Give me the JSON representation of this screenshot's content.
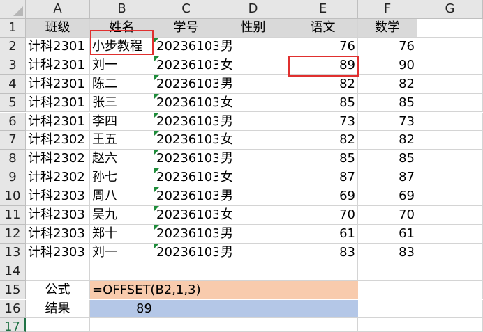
{
  "columns": [
    "A",
    "B",
    "C",
    "D",
    "E",
    "F",
    "G"
  ],
  "rows": [
    "1",
    "2",
    "3",
    "4",
    "5",
    "6",
    "7",
    "8",
    "9",
    "10",
    "11",
    "12",
    "13",
    "14",
    "15",
    "16",
    "17"
  ],
  "headers": [
    "班级",
    "姓名",
    "学号",
    "性别",
    "语文",
    "数学"
  ],
  "records": [
    [
      "计科2301",
      "小步教程",
      "20236103",
      "男",
      "76",
      "76"
    ],
    [
      "计科2301",
      "刘一",
      "20236103",
      "女",
      "89",
      "90"
    ],
    [
      "计科2301",
      "陈二",
      "20236103",
      "男",
      "82",
      "82"
    ],
    [
      "计科2301",
      "张三",
      "20236103",
      "女",
      "85",
      "85"
    ],
    [
      "计科2301",
      "李四",
      "20236103",
      "男",
      "73",
      "73"
    ],
    [
      "计科2302",
      "王五",
      "20236103",
      "女",
      "82",
      "82"
    ],
    [
      "计科2302",
      "赵六",
      "20236103",
      "男",
      "85",
      "85"
    ],
    [
      "计科2302",
      "孙七",
      "20236103",
      "女",
      "87",
      "87"
    ],
    [
      "计科2303",
      "周八",
      "20236103",
      "男",
      "69",
      "69"
    ],
    [
      "计科2303",
      "吴九",
      "20236103",
      "女",
      "70",
      "70"
    ],
    [
      "计科2303",
      "郑十",
      "20236103",
      "男",
      "61",
      "61"
    ],
    [
      "计科2303",
      "刘一",
      "20236103",
      "男",
      "83",
      "83"
    ]
  ],
  "formula": {
    "label": "公式",
    "text": "=OFFSET(B2,1,3)"
  },
  "result": {
    "label": "结果",
    "value": "89"
  },
  "colors": {
    "formula_fill": "#f8cbad",
    "result_fill": "#b4c7e7",
    "highlight_border": "#e0302f",
    "text_flag": "#1e8c3a",
    "selected_row_header": "#217346"
  }
}
